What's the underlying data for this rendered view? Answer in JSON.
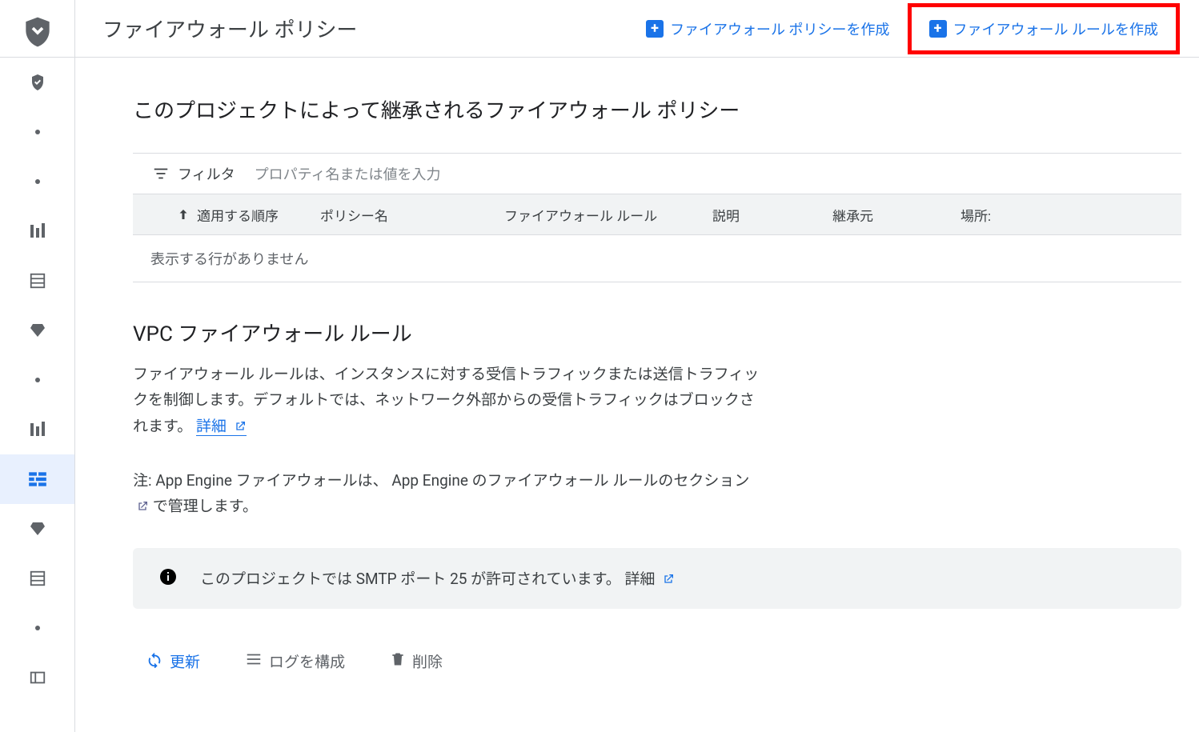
{
  "header": {
    "title": "ファイアウォール ポリシー",
    "create_policy": "ファイアウォール ポリシーを作成",
    "create_rule": "ファイアウォール ルールを作成"
  },
  "section1": {
    "title": "このプロジェクトによって継承されるファイアウォール ポリシー"
  },
  "filter": {
    "label": "フィルタ",
    "placeholder": "プロパティ名または値を入力"
  },
  "table": {
    "columns": {
      "order": "適用する順序",
      "policy_name": "ポリシー名",
      "rules": "ファイアウォール ルール",
      "description": "説明",
      "inherited_from": "継承元",
      "location": "場所:"
    },
    "empty": "表示する行がありません"
  },
  "section2": {
    "title": "VPC ファイアウォール ルール",
    "desc_pre": "ファイアウォール ルールは、インスタンスに対する受信トラフィックまたは送信トラフィックを制御します。デフォルトでは、ネットワーク外部からの受信トラフィックはブロックされます。",
    "learn_more": "詳細",
    "note_pre": "注: App Engine ファイアウォールは、",
    "note_link": "App Engine のファイアウォール ルールのセクション",
    "note_post": "で管理します。"
  },
  "banner": {
    "text_pre": "このプロジェクトでは SMTP ポート 25 が許可されています。",
    "learn_more": "詳細"
  },
  "actions": {
    "refresh": "更新",
    "configure_logs": "ログを構成",
    "delete": "削除"
  }
}
